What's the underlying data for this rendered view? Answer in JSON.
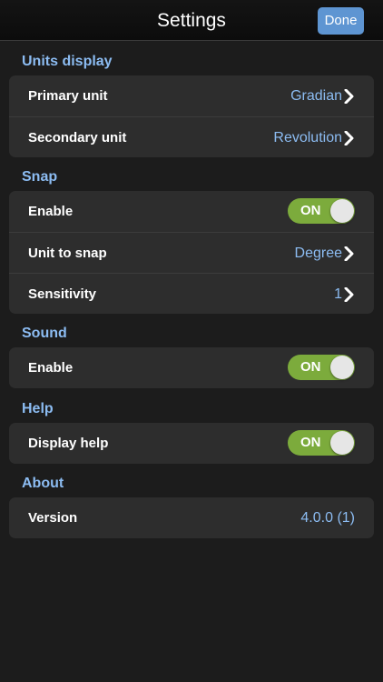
{
  "navbar": {
    "title": "Settings",
    "done_label": "Done"
  },
  "units_display": {
    "header": "Units display",
    "primary_label": "Primary unit",
    "primary_value": "Gradian",
    "secondary_label": "Secondary unit",
    "secondary_value": "Revolution"
  },
  "snap": {
    "header": "Snap",
    "enable_label": "Enable",
    "enable_state": "ON",
    "unit_label": "Unit to snap",
    "unit_value": "Degree",
    "sensitivity_label": "Sensitivity",
    "sensitivity_value": "1"
  },
  "sound": {
    "header": "Sound",
    "enable_label": "Enable",
    "enable_state": "ON"
  },
  "help": {
    "header": "Help",
    "display_label": "Display help",
    "display_state": "ON"
  },
  "about": {
    "header": "About",
    "version_label": "Version",
    "version_value": "4.0.0 (1)"
  },
  "colors": {
    "accent": "#8cbcf2",
    "done_button": "#5e95d2",
    "toggle_on": "#7cab3c",
    "group_bg": "#2d2d2d",
    "page_bg": "#1c1c1c"
  },
  "icons": {
    "disclosure": "chevron-right-icon"
  }
}
